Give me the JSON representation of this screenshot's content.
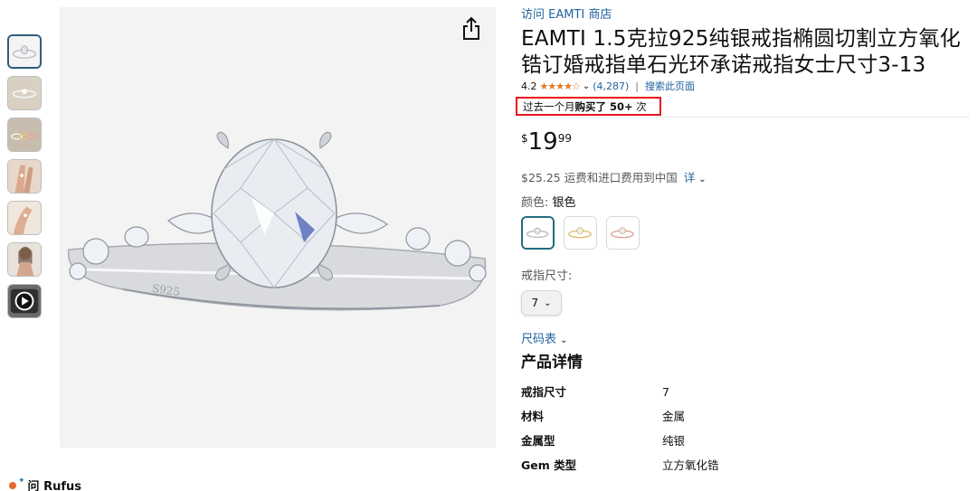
{
  "thumbnails": [
    {
      "name": "thumb-ring-front",
      "selected": true
    },
    {
      "name": "thumb-ring-side",
      "selected": false
    },
    {
      "name": "thumb-ring-set",
      "selected": false
    },
    {
      "name": "thumb-hand-1",
      "selected": false
    },
    {
      "name": "thumb-hand-2",
      "selected": false
    },
    {
      "name": "thumb-model",
      "selected": false
    },
    {
      "name": "thumb-video",
      "selected": false
    }
  ],
  "rufus": {
    "label": "问 Rufus"
  },
  "product": {
    "store_link": "访问 EAMTI 商店",
    "title": "EAMTI 1.5克拉925纯银戒指椭圆切割立方氧化锆订婚戒指单石光环承诺戒指女士尺寸3-13",
    "rating": "4.2",
    "stars": "★★★★☆",
    "review_count": "(4,287)",
    "separator": "|",
    "search_page": "搜索此页面",
    "bought_prefix": "过去一个月",
    "bought_strong": "购买了 50+",
    "bought_suffix": " 次",
    "price_symbol": "$",
    "price_whole": "19",
    "price_fraction": "99",
    "shipping_text": "$25.25 运费和进口费用到中国",
    "shipping_detail": "详",
    "color_label": "颜色:",
    "color_value": "银色",
    "size_label": "戒指尺寸:",
    "size_value": "7",
    "size_chart": "尺码表",
    "details_title": "产品详情",
    "specs": [
      {
        "k": "戒指尺寸",
        "v": "7"
      },
      {
        "k": "材料",
        "v": "金属"
      },
      {
        "k": "金属型",
        "v": "纯银"
      },
      {
        "k": "Gem 类型",
        "v": "立方氧化锆"
      }
    ]
  },
  "colors": {
    "accent_link": "#2162a1",
    "star": "#de7921",
    "highlight_box": "#e8141d",
    "selected_border": "#1f6d7e"
  }
}
